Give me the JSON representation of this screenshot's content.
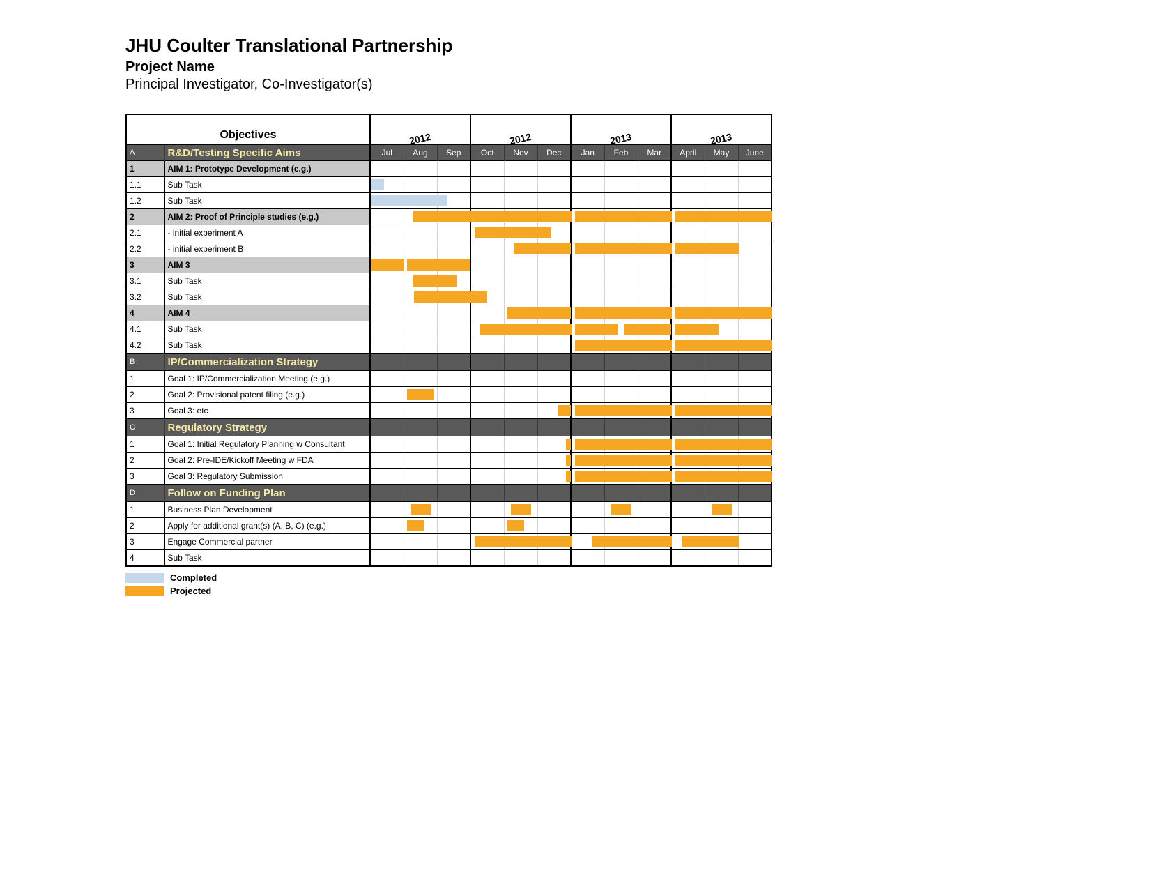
{
  "header": {
    "title": "JHU Coulter Translational Partnership",
    "project": "Project Name",
    "pi": "Principal Investigator, Co-Investigator(s)",
    "objectives_label": "Objectives"
  },
  "years": [
    "2012",
    "2012",
    "2013",
    "2013"
  ],
  "months": [
    "Jul",
    "Aug",
    "Sep",
    "Oct",
    "Nov",
    "Dec",
    "Jan",
    "Feb",
    "Mar",
    "April",
    "May",
    "June"
  ],
  "legend": {
    "completed": "Completed",
    "projected": "Projected"
  },
  "colors": {
    "completed": "#c5d7ea",
    "projected": "#f5a623"
  },
  "chart_data": {
    "type": "gantt",
    "months": [
      "Jul",
      "Aug",
      "Sep",
      "Oct",
      "Nov",
      "Dec",
      "Jan",
      "Feb",
      "Mar",
      "April",
      "May",
      "June"
    ],
    "sections": [
      {
        "key": "A",
        "title": "R&D/Testing Specific Aims",
        "rows": [
          {
            "idx": "1",
            "label": "AIM 1: Prototype Development (e.g.)",
            "aim": true,
            "bars": []
          },
          {
            "idx": "1.1",
            "label": "Sub Task",
            "bars": [
              {
                "type": "completed",
                "startMonth": 0,
                "startFrac": 0.0,
                "endMonth": 0,
                "endFrac": 0.4
              }
            ]
          },
          {
            "idx": "1.2",
            "label": "Sub Task",
            "bars": [
              {
                "type": "completed",
                "startMonth": 0,
                "startFrac": 0.0,
                "endMonth": 2,
                "endFrac": 0.3
              }
            ]
          },
          {
            "idx": "2",
            "label": "AIM 2: Proof of Principle studies (e.g.)",
            "aim": true,
            "bars": [
              {
                "type": "projected",
                "startMonth": 1,
                "startFrac": 0.25,
                "endMonth": 5,
                "endFrac": 1.0
              },
              {
                "type": "projected",
                "startMonth": 6,
                "startFrac": 0.1,
                "endMonth": 8,
                "endFrac": 1.0
              },
              {
                "type": "projected",
                "startMonth": 9,
                "startFrac": 0.1,
                "endMonth": 11,
                "endFrac": 1.0
              }
            ]
          },
          {
            "idx": "2.1",
            "label": " - initial experiment A",
            "bars": [
              {
                "type": "projected",
                "startMonth": 3,
                "startFrac": 0.1,
                "endMonth": 5,
                "endFrac": 0.4
              }
            ]
          },
          {
            "idx": "2.2",
            "label": " - initial experiment B",
            "bars": [
              {
                "type": "projected",
                "startMonth": 4,
                "startFrac": 0.3,
                "endMonth": 5,
                "endFrac": 1.0
              },
              {
                "type": "projected",
                "startMonth": 6,
                "startFrac": 0.1,
                "endMonth": 8,
                "endFrac": 1.0
              },
              {
                "type": "projected",
                "startMonth": 9,
                "startFrac": 0.1,
                "endMonth": 10,
                "endFrac": 1.0
              }
            ]
          },
          {
            "idx": "3",
            "label": "AIM 3",
            "aim": true,
            "bars": [
              {
                "type": "projected",
                "startMonth": 0,
                "startFrac": 0.0,
                "endMonth": 0,
                "endFrac": 1.0
              },
              {
                "type": "projected",
                "startMonth": 1,
                "startFrac": 0.1,
                "endMonth": 2,
                "endFrac": 1.0
              }
            ]
          },
          {
            "idx": "3.1",
            "label": "Sub Task",
            "bars": [
              {
                "type": "projected",
                "startMonth": 1,
                "startFrac": 0.25,
                "endMonth": 2,
                "endFrac": 0.6
              }
            ]
          },
          {
            "idx": "3.2",
            "label": "Sub Task",
            "bars": [
              {
                "type": "projected",
                "startMonth": 1,
                "startFrac": 0.3,
                "endMonth": 3,
                "endFrac": 0.5
              }
            ]
          },
          {
            "idx": "4",
            "label": "AIM 4",
            "aim": true,
            "bars": [
              {
                "type": "projected",
                "startMonth": 4,
                "startFrac": 0.1,
                "endMonth": 5,
                "endFrac": 1.0
              },
              {
                "type": "projected",
                "startMonth": 6,
                "startFrac": 0.1,
                "endMonth": 8,
                "endFrac": 1.0
              },
              {
                "type": "projected",
                "startMonth": 9,
                "startFrac": 0.1,
                "endMonth": 11,
                "endFrac": 1.0
              }
            ]
          },
          {
            "idx": "4.1",
            "label": "Sub Task",
            "bars": [
              {
                "type": "projected",
                "startMonth": 3,
                "startFrac": 0.25,
                "endMonth": 5,
                "endFrac": 1.0
              },
              {
                "type": "projected",
                "startMonth": 6,
                "startFrac": 0.1,
                "endMonth": 7,
                "endFrac": 0.4
              },
              {
                "type": "projected",
                "startMonth": 7,
                "startFrac": 0.6,
                "endMonth": 8,
                "endFrac": 1.0
              },
              {
                "type": "projected",
                "startMonth": 9,
                "startFrac": 0.1,
                "endMonth": 10,
                "endFrac": 0.4
              }
            ]
          },
          {
            "idx": "4.2",
            "label": "Sub Task",
            "bars": [
              {
                "type": "projected",
                "startMonth": 6,
                "startFrac": 0.1,
                "endMonth": 8,
                "endFrac": 1.0
              },
              {
                "type": "projected",
                "startMonth": 9,
                "startFrac": 0.1,
                "endMonth": 11,
                "endFrac": 1.0
              }
            ]
          }
        ]
      },
      {
        "key": "B",
        "title": "IP/Commercialization Strategy",
        "rows": [
          {
            "idx": "1",
            "label": "Goal 1: IP/Commercialization Meeting (e.g.)",
            "bars": []
          },
          {
            "idx": "2",
            "label": "Goal 2: Provisional patent filing (e.g.)",
            "bars": [
              {
                "type": "projected",
                "startMonth": 1,
                "startFrac": 0.1,
                "endMonth": 1,
                "endFrac": 0.9
              }
            ]
          },
          {
            "idx": "3",
            "label": "Goal 3: etc",
            "bars": [
              {
                "type": "projected",
                "startMonth": 5,
                "startFrac": 0.6,
                "endMonth": 5,
                "endFrac": 1.0
              },
              {
                "type": "projected",
                "startMonth": 6,
                "startFrac": 0.1,
                "endMonth": 8,
                "endFrac": 1.0
              },
              {
                "type": "projected",
                "startMonth": 9,
                "startFrac": 0.1,
                "endMonth": 11,
                "endFrac": 1.0
              }
            ]
          }
        ]
      },
      {
        "key": "C",
        "title": "Regulatory Strategy",
        "rows": [
          {
            "idx": "1",
            "label": "Goal 1: Initial Regulatory Planning w Consultant",
            "bars": [
              {
                "type": "projected",
                "startMonth": 5,
                "startFrac": 0.85,
                "endMonth": 5,
                "endFrac": 1.0
              },
              {
                "type": "projected",
                "startMonth": 6,
                "startFrac": 0.1,
                "endMonth": 8,
                "endFrac": 1.0
              },
              {
                "type": "projected",
                "startMonth": 9,
                "startFrac": 0.1,
                "endMonth": 11,
                "endFrac": 1.0
              }
            ]
          },
          {
            "idx": "2",
            "label": "Goal 2: Pre-IDE/Kickoff Meeting w FDA",
            "bars": [
              {
                "type": "projected",
                "startMonth": 5,
                "startFrac": 0.85,
                "endMonth": 5,
                "endFrac": 1.0
              },
              {
                "type": "projected",
                "startMonth": 6,
                "startFrac": 0.1,
                "endMonth": 8,
                "endFrac": 1.0
              },
              {
                "type": "projected",
                "startMonth": 9,
                "startFrac": 0.1,
                "endMonth": 11,
                "endFrac": 1.0
              }
            ]
          },
          {
            "idx": "3",
            "label": "Goal 3: Regulatory Submission",
            "bars": [
              {
                "type": "projected",
                "startMonth": 5,
                "startFrac": 0.85,
                "endMonth": 5,
                "endFrac": 1.0
              },
              {
                "type": "projected",
                "startMonth": 6,
                "startFrac": 0.1,
                "endMonth": 8,
                "endFrac": 1.0
              },
              {
                "type": "projected",
                "startMonth": 9,
                "startFrac": 0.1,
                "endMonth": 11,
                "endFrac": 1.0
              }
            ]
          }
        ]
      },
      {
        "key": "D",
        "title": "Follow on Funding Plan",
        "rows": [
          {
            "idx": "1",
            "label": "Business Plan Development",
            "bars": [
              {
                "type": "projected",
                "startMonth": 1,
                "startFrac": 0.2,
                "endMonth": 1,
                "endFrac": 0.8
              },
              {
                "type": "projected",
                "startMonth": 4,
                "startFrac": 0.2,
                "endMonth": 4,
                "endFrac": 0.8
              },
              {
                "type": "projected",
                "startMonth": 7,
                "startFrac": 0.2,
                "endMonth": 7,
                "endFrac": 0.8
              },
              {
                "type": "projected",
                "startMonth": 10,
                "startFrac": 0.2,
                "endMonth": 10,
                "endFrac": 0.8
              }
            ]
          },
          {
            "idx": "2",
            "label": "Apply for additional grant(s) (A, B, C) (e.g.)",
            "bars": [
              {
                "type": "projected",
                "startMonth": 1,
                "startFrac": 0.1,
                "endMonth": 1,
                "endFrac": 0.6
              },
              {
                "type": "projected",
                "startMonth": 4,
                "startFrac": 0.1,
                "endMonth": 4,
                "endFrac": 0.6
              }
            ]
          },
          {
            "idx": "3",
            "label": "Engage Commercial partner",
            "bars": [
              {
                "type": "projected",
                "startMonth": 3,
                "startFrac": 0.1,
                "endMonth": 5,
                "endFrac": 1.0
              },
              {
                "type": "projected",
                "startMonth": 6,
                "startFrac": 0.6,
                "endMonth": 8,
                "endFrac": 1.0
              },
              {
                "type": "projected",
                "startMonth": 9,
                "startFrac": 0.3,
                "endMonth": 10,
                "endFrac": 1.0
              }
            ]
          },
          {
            "idx": "4",
            "label": "Sub Task",
            "bars": []
          }
        ]
      }
    ]
  }
}
